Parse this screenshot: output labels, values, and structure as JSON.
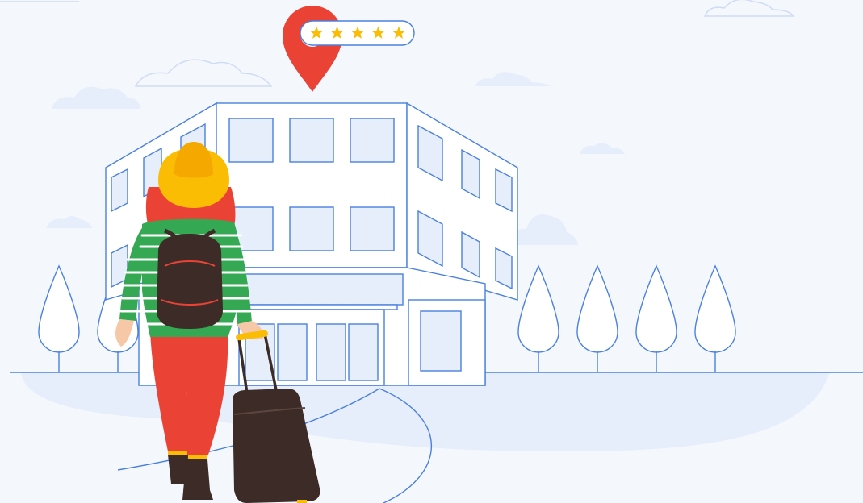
{
  "scene": {
    "rating": {
      "stars": 5,
      "max_stars": 5,
      "star_color": "#fbbc04"
    },
    "colors": {
      "background": "#f4f8fd",
      "outline": "#4a80e0",
      "cloud_fill": "#e6eefb",
      "ground_fill": "#e6eefb",
      "window_fill": "#e7eefb",
      "pin_red": "#ea4335",
      "hat_yellow": "#fbbc04",
      "hair_red": "#ea4335",
      "shirt_green": "#34a853",
      "backpack": "#3c2b27",
      "suitcase": "#3c2b27",
      "handle_yellow": "#fbbc04",
      "pants_red": "#ea4335"
    },
    "icons": {
      "map_pin": "map-pin-icon",
      "star": "star-icon"
    }
  }
}
